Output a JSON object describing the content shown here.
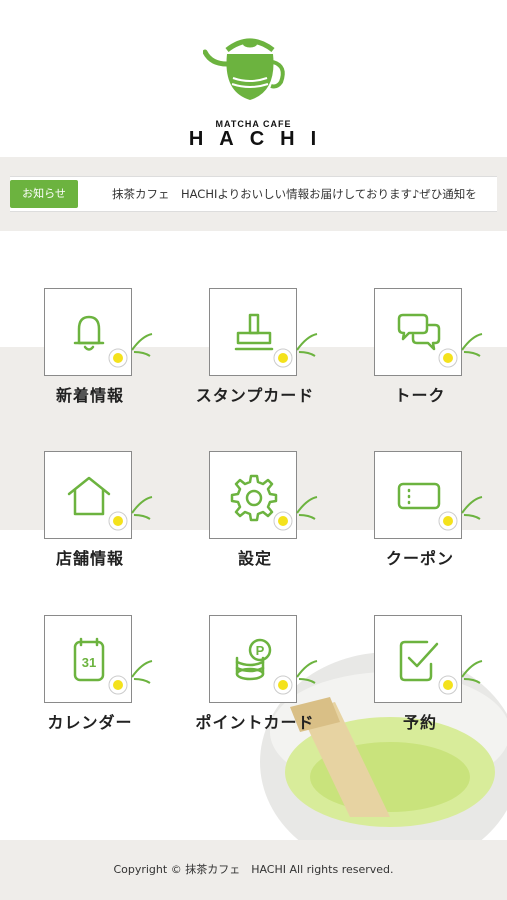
{
  "header": {
    "brand_small": "MATCHA CAFE",
    "brand_main": "HACHI",
    "logo_icon": "teapot-icon",
    "accent_color": "#6cb33f"
  },
  "news": {
    "badge": "お知らせ",
    "text": "抹茶カフェ　HACHIよりおいしい情報お届けしております♪ぜひ通知を"
  },
  "menu": [
    {
      "label": "新着情報",
      "icon": "bell-icon"
    },
    {
      "label": "スタンプカード",
      "icon": "stamp-icon"
    },
    {
      "label": "トーク",
      "icon": "chat-bubbles-icon"
    },
    {
      "label": "店舗情報",
      "icon": "house-icon"
    },
    {
      "label": "設定",
      "icon": "gear-icon"
    },
    {
      "label": "クーポン",
      "icon": "coupon-icon"
    },
    {
      "label": "カレンダー",
      "icon": "calendar-icon"
    },
    {
      "label": "ポイントカード",
      "icon": "coins-icon"
    },
    {
      "label": "予約",
      "icon": "checklist-icon"
    }
  ],
  "calendar_day": "31",
  "coin_letter": "P",
  "footer": {
    "copyright": "Copyright © 抹茶カフェ　HACHI All rights reserved."
  }
}
